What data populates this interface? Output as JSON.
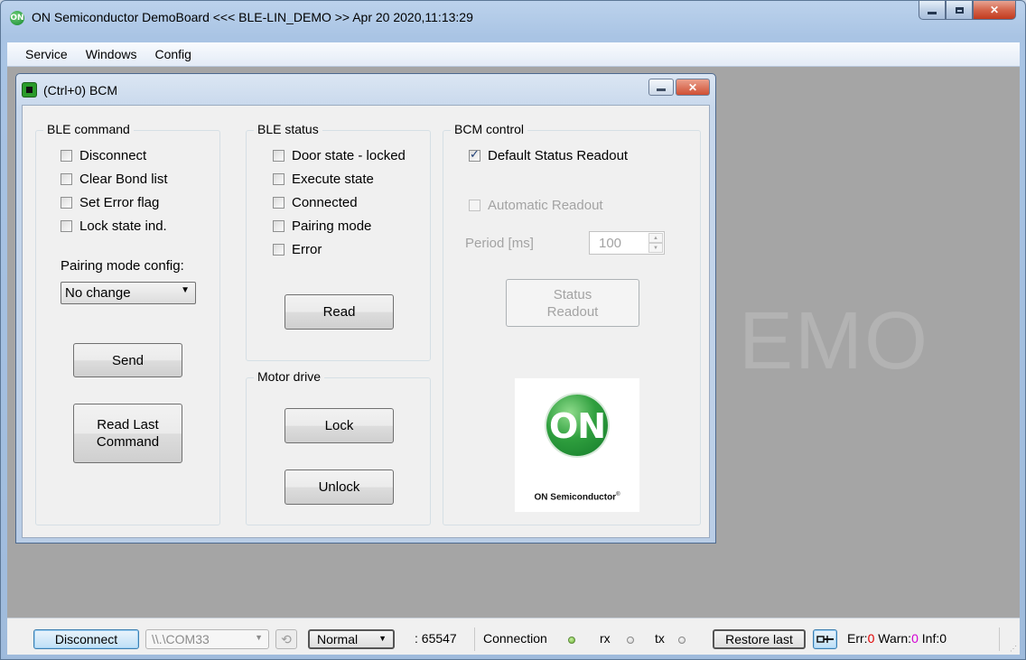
{
  "window": {
    "title": "ON Semiconductor DemoBoard <<< BLE-LIN_DEMO >> Apr 20 2020,11:13:29",
    "icon_label": "ON"
  },
  "menu": {
    "items": [
      "Service",
      "Windows",
      "Config"
    ]
  },
  "background_watermark": "EMO",
  "child_window": {
    "title": "(Ctrl+0) BCM"
  },
  "ble_command": {
    "title": "BLE command",
    "checkboxes": [
      {
        "label": "Disconnect",
        "checked": false
      },
      {
        "label": "Clear Bond list",
        "checked": false
      },
      {
        "label": "Set Error flag",
        "checked": false
      },
      {
        "label": "Lock state ind.",
        "checked": false
      }
    ],
    "pairing_label": "Pairing mode config:",
    "pairing_value": "No change",
    "send_label": "Send",
    "read_last_label_1": "Read Last",
    "read_last_label_2": "Command"
  },
  "ble_status": {
    "title": "BLE status",
    "checkboxes": [
      {
        "label": "Door state - locked",
        "checked": false
      },
      {
        "label": "Execute state",
        "checked": false
      },
      {
        "label": "Connected",
        "checked": false
      },
      {
        "label": "Pairing mode",
        "checked": false
      },
      {
        "label": "Error",
        "checked": false
      }
    ],
    "read_label": "Read"
  },
  "motor_drive": {
    "title": "Motor drive",
    "lock_label": "Lock",
    "unlock_label": "Unlock"
  },
  "bcm_control": {
    "title": "BCM control",
    "default_status_label": "Default Status Readout",
    "default_status_checked": true,
    "automatic_label": "Automatic Readout",
    "automatic_checked": false,
    "period_label": "Period [ms]",
    "period_value": "100",
    "status_readout_1": "Status",
    "status_readout_2": "Readout",
    "logo_letters": "ON",
    "logo_text": "ON Semiconductor"
  },
  "statusbar": {
    "disconnect_label": "Disconnect",
    "port_value": "\\\\.\\COM33",
    "mode_value": "Normal",
    "id_value": ": 65547",
    "connection_label": "Connection",
    "rx_label": "rx",
    "tx_label": "tx",
    "restore_label": "Restore last",
    "err_label": "Err:",
    "err_value": "0",
    "warn_label": "Warn:",
    "warn_value": "0",
    "inf_label": "Inf:",
    "inf_value": "0"
  },
  "colors": {
    "error_count": "#e00000",
    "warn_count": "#d400d4",
    "connection_led": "#6bb22f"
  }
}
